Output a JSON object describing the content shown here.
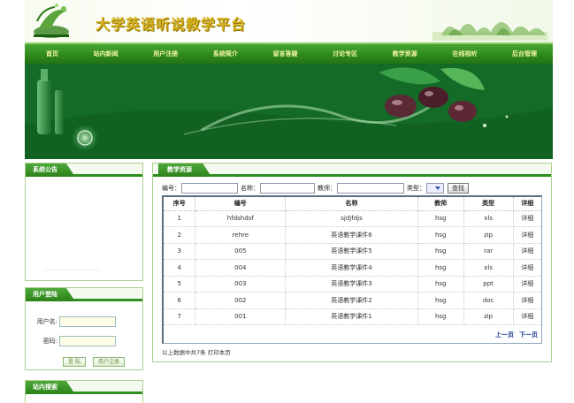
{
  "header": {
    "site_title": "大学英语听说教学平台"
  },
  "nav": [
    "首页",
    "站内新闻",
    "用户注册",
    "系统简介",
    "留言答疑",
    "讨论专区",
    "教学资源",
    "在线视听",
    "后台管理"
  ],
  "left": {
    "notice_title": "系统公告",
    "login_title": "用户登陆",
    "username_label": "用户名:",
    "password_label": "密码:",
    "login_button": "登 陆",
    "register_button": "用户注册",
    "site_search_title": "站内搜索"
  },
  "main": {
    "title": "教学资源",
    "search": {
      "code_label": "编号：",
      "name_label": "名称：",
      "teacher_label": "教师：",
      "type_label": "类型：",
      "query_button": "查找"
    },
    "columns": [
      "序号",
      "编号",
      "名称",
      "教师",
      "类型",
      "详细"
    ],
    "rows": [
      [
        "1",
        "hfdshdsf",
        "sjdjfdjs",
        "hsg",
        "xls",
        "详细"
      ],
      [
        "2",
        "rehre",
        "英语教学课件6",
        "hsg",
        "zip",
        "详细"
      ],
      [
        "3",
        "005",
        "英语教学课件5",
        "hsg",
        "rar",
        "详细"
      ],
      [
        "4",
        "004",
        "英语教学课件4",
        "hsg",
        "xls",
        "详细"
      ],
      [
        "5",
        "003",
        "英语教学课件3",
        "hsg",
        "ppt",
        "详细"
      ],
      [
        "6",
        "002",
        "英语教学课件2",
        "hsg",
        "doc",
        "详细"
      ],
      [
        "7",
        "001",
        "英语教学课件1",
        "hsg",
        "zip",
        "详细"
      ]
    ],
    "pager": {
      "prev": "上一页",
      "next": "下一页"
    },
    "footer_note": "以上数据中共7条  打印本页"
  },
  "colors": {
    "nav_green": "#2e8a1c",
    "title_gold": "#d7b21c",
    "link_blue": "#1b3c8f"
  },
  "icons": [
    "logo-emblem-icon",
    "select-arrow-icon"
  ]
}
